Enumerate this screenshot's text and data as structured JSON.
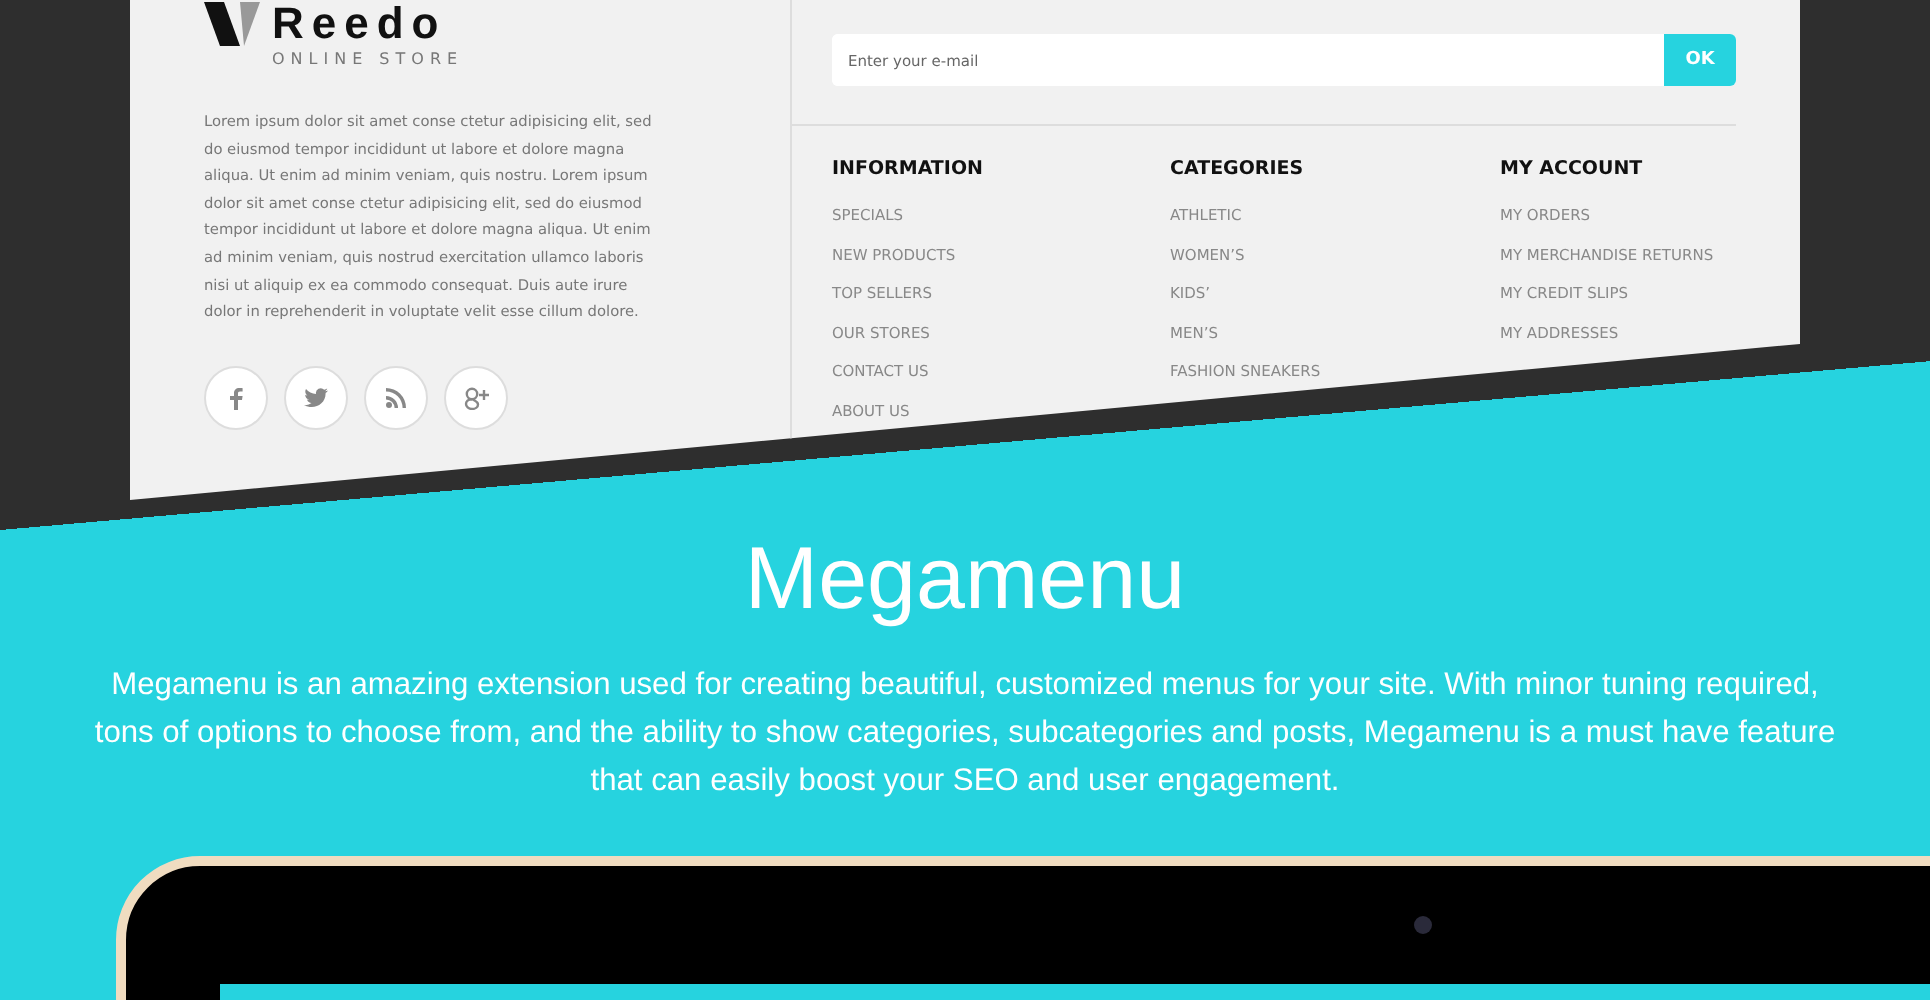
{
  "store": {
    "logo": "Reedo",
    "tagline": "ONLINE STORE",
    "about": "Lorem ipsum dolor sit amet conse ctetur adipisicing elit, sed do eiusmod tempor incididunt ut labore et dolore magna aliqua. Ut enim ad minim veniam, quis nostru. Lorem ipsum dolor sit amet conse ctetur adipisicing elit, sed do eiusmod tempor incididunt ut labore et dolore magna aliqua. Ut enim ad minim veniam, quis nostrud exercitation ullamco laboris nisi ut aliquip ex ea commodo consequat. Duis aute irure dolor in reprehenderit in voluptate velit esse cillum dolore.",
    "social": [
      {
        "kind": "facebook"
      },
      {
        "kind": "twitter"
      },
      {
        "kind": "rss"
      },
      {
        "kind": "google"
      }
    ],
    "newsletter": {
      "placeholder": "Enter your e-mail",
      "button": "OK"
    },
    "columns": [
      {
        "title": "INFORMATION",
        "links": [
          "SPECIALS",
          "NEW PRODUCTS",
          "TOP SELLERS",
          "OUR STORES",
          "CONTACT US",
          "ABOUT US"
        ]
      },
      {
        "title": "CATEGORIES",
        "links": [
          "ATHLETIC",
          "WOMEN’S",
          "KIDS’",
          "MEN’S",
          "FASHION SNEAKERS"
        ]
      },
      {
        "title": "MY ACCOUNT",
        "links": [
          "MY ORDERS",
          "MY MERCHANDISE RETURNS",
          "MY CREDIT SLIPS",
          "MY ADDRESSES"
        ]
      }
    ]
  },
  "feature": {
    "title": "Megamenu",
    "description": "Megamenu is an amazing extension used for creating beautiful, customized menus for your site. With minor tuning required, tons of options to choose from, and the ability to show categories, subcategories and posts, Megamenu is a must have feature that can easily boost your SEO and user engagement."
  }
}
